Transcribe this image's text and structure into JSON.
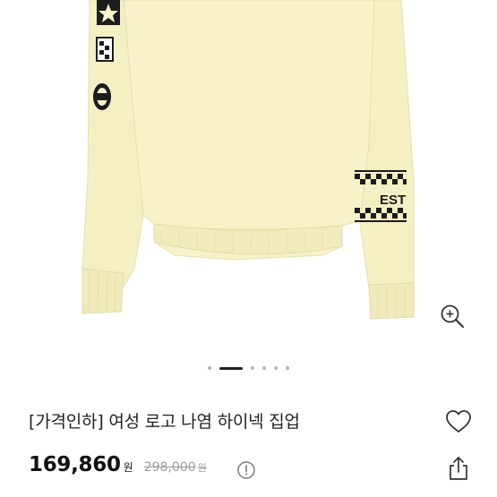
{
  "product": {
    "title": "[가격인하] 여성 로고 나염 하이넥 집업",
    "sale_price": "169,860",
    "sale_currency": "원",
    "original_price": "298,000",
    "original_currency": "원",
    "sleeve_print_text": "EST"
  },
  "carousel": {
    "total_slides": 6,
    "active_index": 1
  },
  "icons": {
    "zoom": "zoom-in-icon",
    "wishlist": "heart-outline-icon",
    "info": "info-circle-icon",
    "share": "share-icon"
  },
  "colors": {
    "garment": "#f7f2c8",
    "print": "#1c1c1c",
    "active_dot": "#222222",
    "inactive_dot": "#b5b5b5",
    "strike_price": "#9a9a9a"
  }
}
